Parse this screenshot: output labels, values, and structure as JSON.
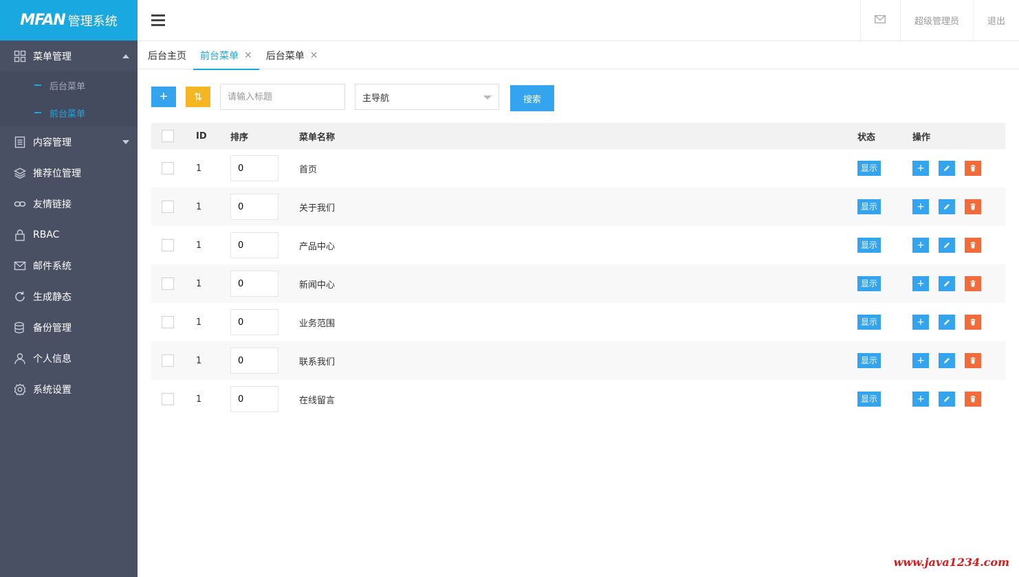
{
  "logo": {
    "brand": "MFAN",
    "text": "管理系统"
  },
  "sidebar": {
    "items": [
      {
        "label": "菜单管理",
        "icon": "grid-icon",
        "expanded": true,
        "children": [
          {
            "label": "后台菜单",
            "active": false
          },
          {
            "label": "前台菜单",
            "active": true
          }
        ]
      },
      {
        "label": "内容管理",
        "icon": "document-icon",
        "expanded": false
      },
      {
        "label": "推荐位管理",
        "icon": "layers-icon"
      },
      {
        "label": "友情链接",
        "icon": "link-icon"
      },
      {
        "label": "RBAC",
        "icon": "lock-icon"
      },
      {
        "label": "邮件系统",
        "icon": "mail-icon"
      },
      {
        "label": "生成静态",
        "icon": "refresh-icon"
      },
      {
        "label": "备份管理",
        "icon": "database-icon"
      },
      {
        "label": "个人信息",
        "icon": "user-icon"
      },
      {
        "label": "系统设置",
        "icon": "gear-icon"
      }
    ]
  },
  "header": {
    "user": "超级管理员",
    "logout": "退出"
  },
  "tabs": [
    {
      "label": "后台主页",
      "closable": false,
      "active": false
    },
    {
      "label": "前台菜单",
      "closable": true,
      "active": true
    },
    {
      "label": "后台菜单",
      "closable": true,
      "active": false
    }
  ],
  "toolbar": {
    "add": "+",
    "sort": "⇅",
    "search_placeholder": "请输入标题",
    "select_value": "主导航",
    "search_button": "搜索"
  },
  "table": {
    "columns": [
      "ID",
      "排序",
      "菜单名称",
      "状态",
      "操作"
    ],
    "rows": [
      {
        "id": "1",
        "sort": "0",
        "name": "首页",
        "status": "显示"
      },
      {
        "id": "1",
        "sort": "0",
        "name": "关于我们",
        "status": "显示"
      },
      {
        "id": "1",
        "sort": "0",
        "name": "产品中心",
        "status": "显示"
      },
      {
        "id": "1",
        "sort": "0",
        "name": "新闻中心",
        "status": "显示"
      },
      {
        "id": "1",
        "sort": "0",
        "name": "业务范围",
        "status": "显示"
      },
      {
        "id": "1",
        "sort": "0",
        "name": "联系我们",
        "status": "显示"
      },
      {
        "id": "1",
        "sort": "0",
        "name": "在线留言",
        "status": "显示"
      }
    ]
  },
  "watermark": "www.java1234.com",
  "colors": {
    "accent": "#1aa8e0",
    "sidebar": "#4a5064",
    "primary_button": "#35a4ee",
    "warn_button": "#f5b624",
    "danger_button": "#f26b3a"
  }
}
